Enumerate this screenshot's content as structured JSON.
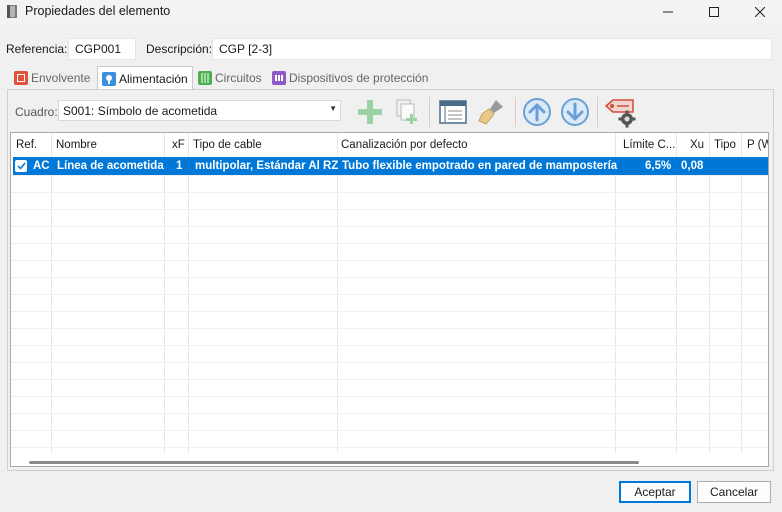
{
  "window": {
    "title": "Propiedades del elemento"
  },
  "fields": {
    "referencia_label": "Referencia:",
    "referencia_value": "CGP001",
    "descripcion_label": "Descripción:",
    "descripcion_value": "CGP [2-3]"
  },
  "tabs": [
    {
      "label": "Envolvente",
      "icon": "box-red-icon",
      "color": "#e0503a"
    },
    {
      "label": "Alimentación",
      "icon": "lightbulb-icon",
      "color": "#3a8fe0"
    },
    {
      "label": "Circuitos",
      "icon": "circuits-icon",
      "color": "#4caf50"
    },
    {
      "label": "Dispositivos de protección",
      "icon": "breakers-icon",
      "color": "#8e5ac8"
    }
  ],
  "toolbar": {
    "cuadro_label": "Cuadro:",
    "cuadro_value": "S001: Símbolo de acometida",
    "buttons": [
      "add-icon",
      "copy-add-icon",
      "table-edit-icon",
      "brush-icon",
      "arrow-up-icon",
      "arrow-down-icon",
      "tag-settings-icon"
    ]
  },
  "table": {
    "columns": [
      "Ref.",
      "Nombre",
      "xF",
      "Tipo de cable",
      "Canalización por defecto",
      "Límite C...",
      "Xu",
      "Tipo",
      "P (W"
    ],
    "rows": [
      {
        "checked": true,
        "ref": "AC",
        "nombre": "Línea de acometida",
        "xf": "1",
        "tipo_cable": "multipolar, Estándar Al RZ",
        "canalizacion": "Tubo flexible empotrado en pared de mampostería",
        "limite": "6,5%",
        "xu": "0,08",
        "tipo": "",
        "p": ""
      }
    ]
  },
  "footer": {
    "accept_label": "Aceptar",
    "cancel_label": "Cancelar"
  },
  "colors": {
    "selection": "#0078d7",
    "accent": "#0078d7"
  }
}
